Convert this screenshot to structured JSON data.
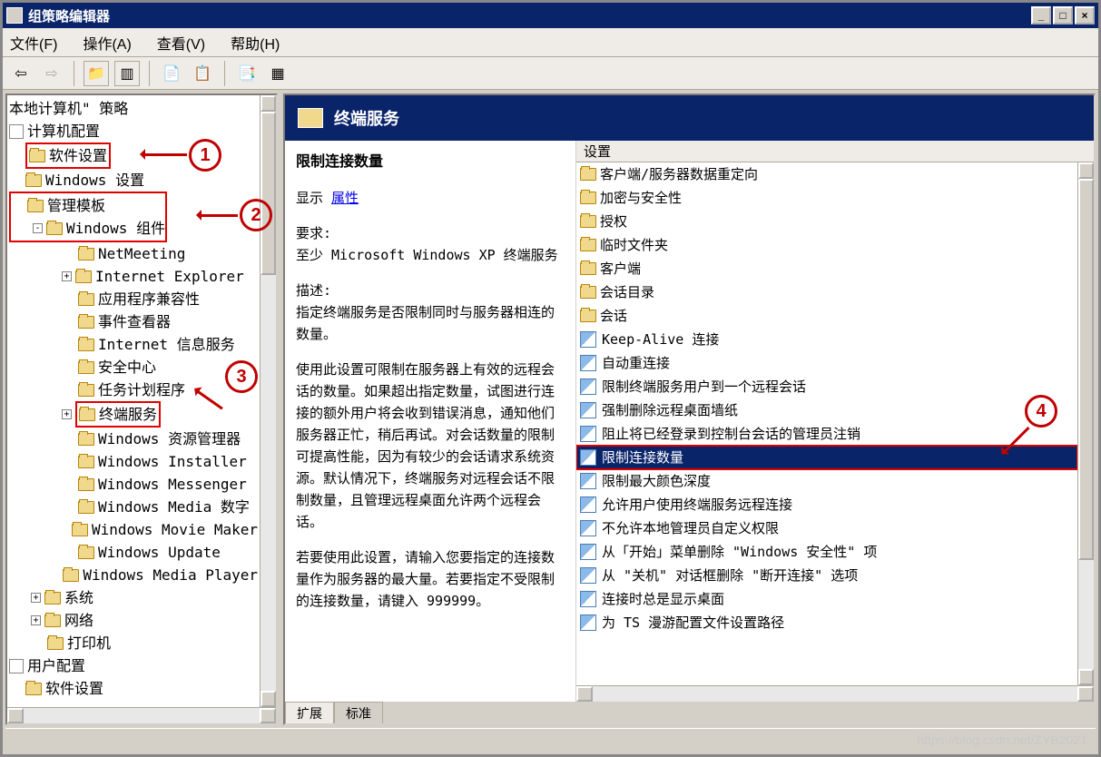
{
  "window": {
    "title": "组策略编辑器"
  },
  "menubar": {
    "file": "文件(F)",
    "action": "操作(A)",
    "view": "查看(V)",
    "help": "帮助(H)"
  },
  "tree": {
    "root": "本地计算机\" 策略",
    "computer_config": "计算机配置",
    "software_settings": "软件设置",
    "windows_settings": "Windows 设置",
    "admin_templates": "管理模板",
    "windows_components": "Windows 组件",
    "netmeeting": "NetMeeting",
    "ie": "Internet Explorer",
    "appcompat": "应用程序兼容性",
    "eventviewer": "事件查看器",
    "iis": "Internet 信息服务",
    "securitycenter": "安全中心",
    "taskscheduler": "任务计划程序",
    "terminalservices": "终端服务",
    "windows_rm": "Windows 资源管理器",
    "windows_installer": "Windows Installer",
    "windows_messenger": "Windows Messenger",
    "windows_media_digital": "Windows Media 数字",
    "windows_movie_maker": "Windows Movie Maker",
    "windows_update": "Windows Update",
    "windows_media_player": "Windows Media Player",
    "system": "系统",
    "network": "网络",
    "printers": "打印机",
    "user_config": "用户配置",
    "user_software": "软件设置"
  },
  "right": {
    "header": "终端服务",
    "desc_title": "限制连接数量",
    "show": "显示",
    "properties": "属性",
    "req_label": "要求:",
    "req_text": "至少 Microsoft Windows XP 终端服务",
    "desc_label": "描述:",
    "desc1": "指定终端服务是否限制同时与服务器相连的数量。",
    "desc2": "使用此设置可限制在服务器上有效的远程会话的数量。如果超出指定数量，试图进行连接的额外用户将会收到错误消息，通知他们服务器正忙，稍后再试。对会话数量的限制可提高性能，因为有较少的会话请求系统资源。默认情况下，终端服务对远程会话不限制数量，且管理远程桌面允许两个远程会话。",
    "desc3": "若要使用此设置，请输入您要指定的连接数量作为服务器的最大量。若要指定不受限制的连接数量，请键入 999999。",
    "list_header": "设置",
    "tabs": {
      "ext": "扩展",
      "std": "标准"
    },
    "items": [
      {
        "type": "folder",
        "label": "客户端/服务器数据重定向"
      },
      {
        "type": "folder",
        "label": "加密与安全性"
      },
      {
        "type": "folder",
        "label": "授权"
      },
      {
        "type": "folder",
        "label": "临时文件夹"
      },
      {
        "type": "folder",
        "label": "客户端"
      },
      {
        "type": "folder",
        "label": "会话目录"
      },
      {
        "type": "folder",
        "label": "会话"
      },
      {
        "type": "policy",
        "label": "Keep-Alive 连接"
      },
      {
        "type": "policy",
        "label": "自动重连接"
      },
      {
        "type": "policy",
        "label": "限制终端服务用户到一个远程会话"
      },
      {
        "type": "policy",
        "label": "强制删除远程桌面墙纸"
      },
      {
        "type": "policy",
        "label": "阻止将已经登录到控制台会话的管理员注销"
      },
      {
        "type": "policy",
        "label": "限制连接数量",
        "selected": true
      },
      {
        "type": "policy",
        "label": "限制最大颜色深度"
      },
      {
        "type": "policy",
        "label": "允许用户使用终端服务远程连接"
      },
      {
        "type": "policy",
        "label": "不允许本地管理员自定义权限"
      },
      {
        "type": "policy",
        "label": "从「开始」菜单删除 \"Windows 安全性\" 项"
      },
      {
        "type": "policy",
        "label": "从 \"关机\" 对话框删除 \"断开连接\" 选项"
      },
      {
        "type": "policy",
        "label": "连接时总是显示桌面"
      },
      {
        "type": "policy",
        "label": "为 TS 漫游配置文件设置路径"
      }
    ]
  },
  "annotations": {
    "a1": "1",
    "a2": "2",
    "a3": "3",
    "a4": "4"
  },
  "watermark": "https://blog.csdn.net/ZYB2021"
}
